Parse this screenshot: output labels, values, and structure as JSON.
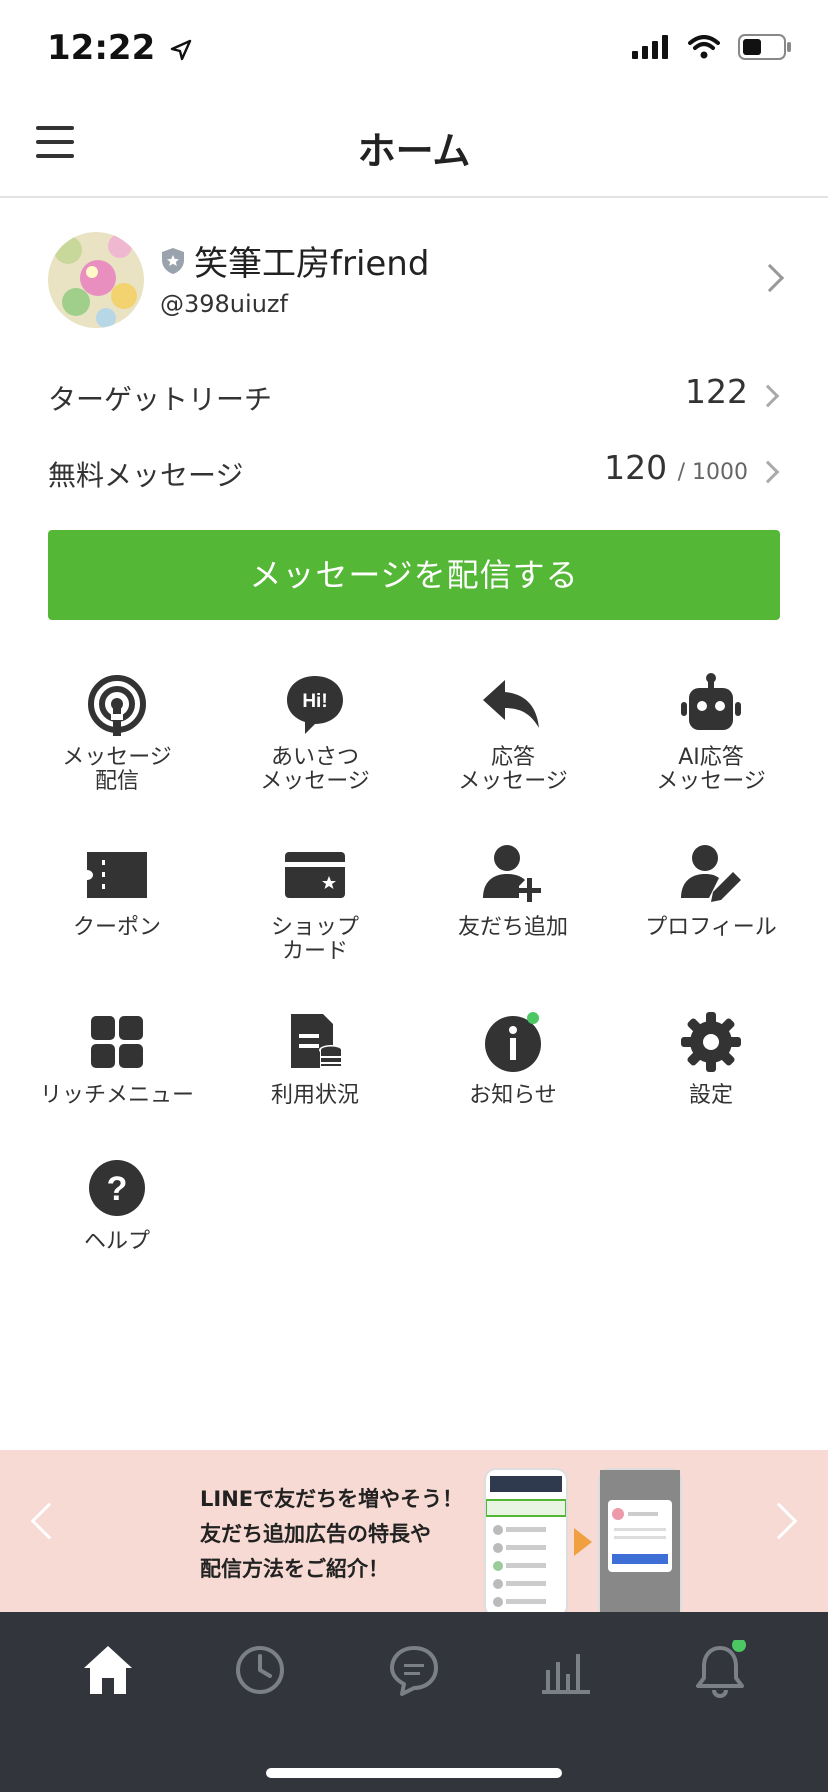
{
  "status_bar": {
    "time": "12:22"
  },
  "header": {
    "title": "ホーム"
  },
  "profile": {
    "name": "笑筆工房friend",
    "id": "@398uiuzf"
  },
  "stats": {
    "target_reach_label": "ターゲットリーチ",
    "target_reach_value": "122",
    "free_message_label": "無料メッセージ",
    "free_message_value": "120",
    "free_message_limit": "/ 1000"
  },
  "send_button": {
    "label": "メッセージを配信する"
  },
  "menu": [
    {
      "label": "メッセージ\n配信",
      "icon": "broadcast-icon"
    },
    {
      "label": "あいさつ\nメッセージ",
      "icon": "hi-bubble-icon"
    },
    {
      "label": "応答\nメッセージ",
      "icon": "reply-icon"
    },
    {
      "label": "AI応答\nメッセージ",
      "icon": "robot-icon"
    },
    {
      "label": "クーポン",
      "icon": "coupon-icon"
    },
    {
      "label": "ショップ\nカード",
      "icon": "shop-card-icon"
    },
    {
      "label": "友だち追加",
      "icon": "add-friend-icon"
    },
    {
      "label": "プロフィール",
      "icon": "profile-edit-icon"
    },
    {
      "label": "リッチメニュー",
      "icon": "rich-menu-icon"
    },
    {
      "label": "利用状況",
      "icon": "usage-icon"
    },
    {
      "label": "お知らせ",
      "icon": "info-icon"
    },
    {
      "label": "設定",
      "icon": "gear-icon"
    },
    {
      "label": "ヘルプ",
      "icon": "help-icon"
    }
  ],
  "banner": {
    "text": "LINEで友だちを増やそう！\n友だち追加広告の特長や\n配信方法をご紹介！"
  },
  "tabbar": [
    "home-icon",
    "clock-icon",
    "chat-icon",
    "chart-icon",
    "bell-icon"
  ],
  "colors": {
    "accent": "#55b736",
    "tabbar": "#32353b",
    "banner_bg": "#f6dad3",
    "badge": "#4cc764"
  }
}
